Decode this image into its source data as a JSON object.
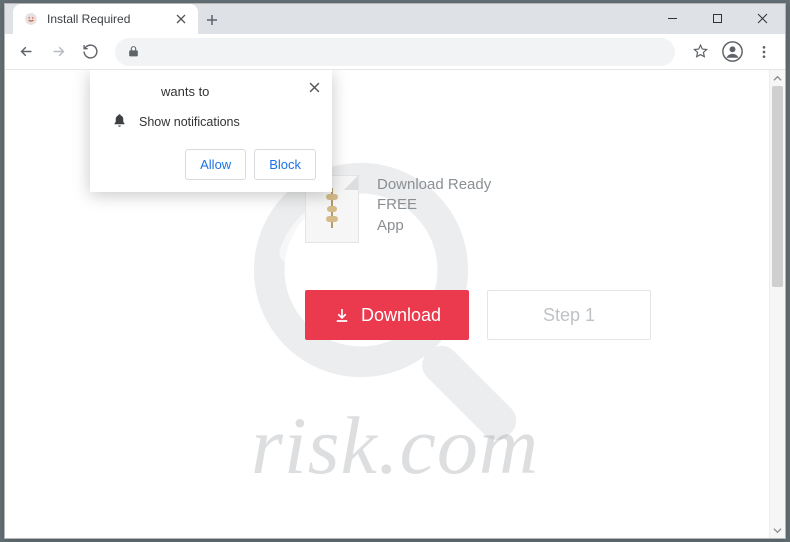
{
  "window": {
    "tab_title": "Install Required"
  },
  "permission": {
    "title": "wants to",
    "item": "Show notifications",
    "allow": "Allow",
    "block": "Block"
  },
  "content": {
    "ready_line1": "Download Ready",
    "ready_line2": "FREE",
    "ready_line3": "App",
    "download_label": "Download",
    "step_label": "Step 1"
  },
  "watermark": {
    "text": "risk.com"
  }
}
